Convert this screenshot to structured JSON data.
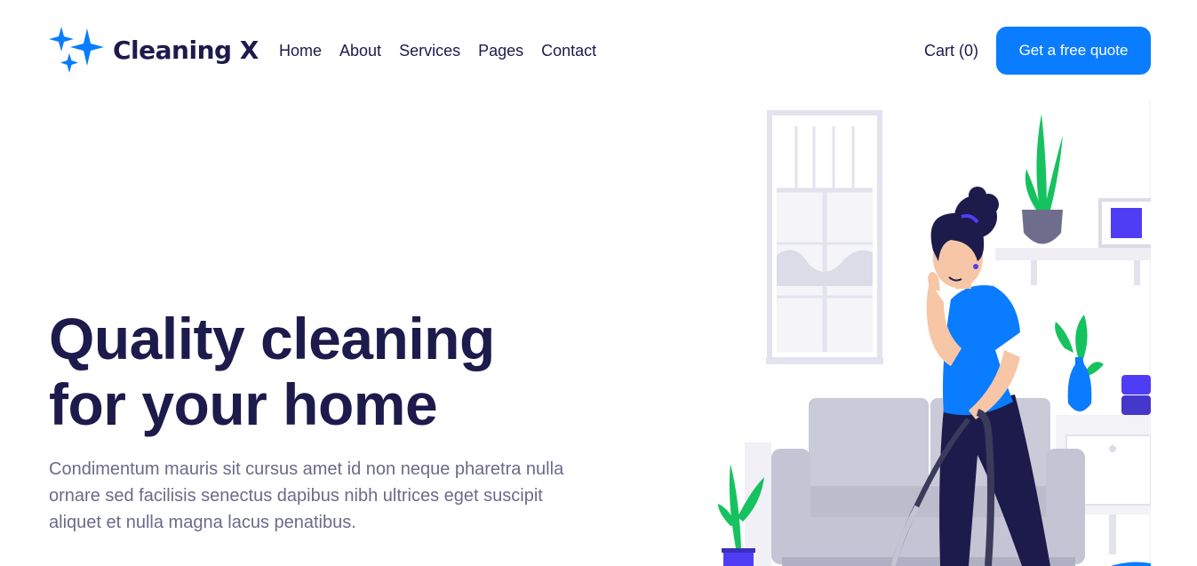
{
  "brand": {
    "name": "Cleaning X",
    "icon": "sparkle-icon",
    "color": "#0a7cff"
  },
  "nav": {
    "items": [
      {
        "label": "Home"
      },
      {
        "label": "About"
      },
      {
        "label": "Services"
      },
      {
        "label": "Pages"
      },
      {
        "label": "Contact"
      }
    ]
  },
  "header": {
    "cart_label": "Cart (0)",
    "cta_label": "Get a free quote"
  },
  "hero": {
    "title_line1": "Quality cleaning",
    "title_line2": "for your home",
    "description": "Condimentum mauris sit cursus amet id non neque pharetra nulla ornare sed facilisis senectus dapibus nibh ultrices eget suscipit aliquet et nulla magna lacus penatibus."
  },
  "colors": {
    "primary": "#0a7cff",
    "heading": "#1d1b4c",
    "body_text": "#6b6b8a",
    "accent_purple": "#4f3df5",
    "plant_green": "#16c25f"
  }
}
